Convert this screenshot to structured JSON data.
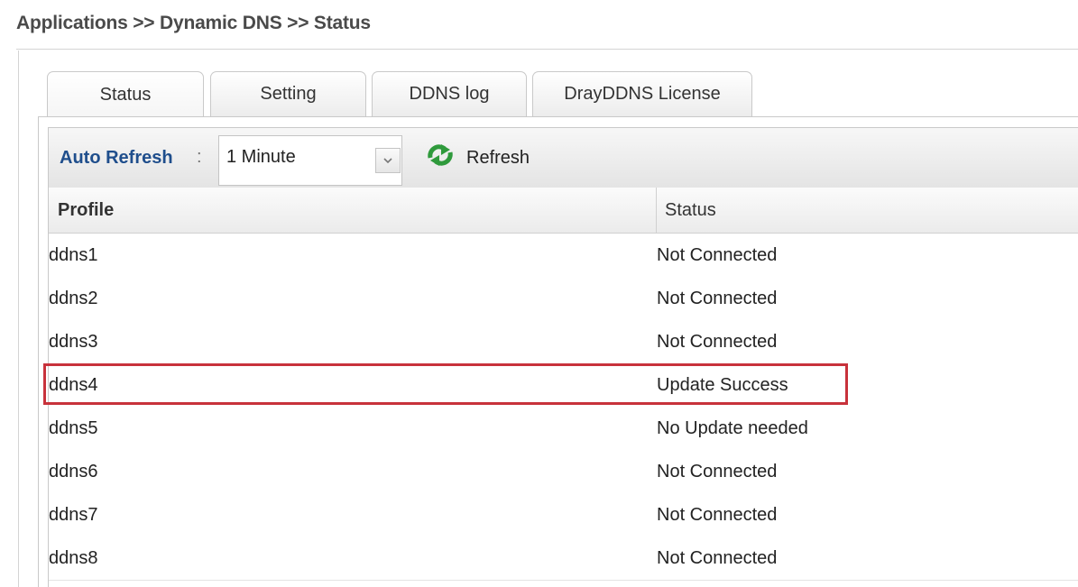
{
  "breadcrumb": "Applications >> Dynamic DNS >> Status",
  "tabs": [
    {
      "label": "Status",
      "active": true
    },
    {
      "label": "Setting",
      "active": false
    },
    {
      "label": "DDNS log",
      "active": false
    },
    {
      "label": "DrayDDNS License",
      "active": false
    }
  ],
  "toolbar": {
    "auto_refresh_label": "Auto Refresh",
    "colon": ":",
    "auto_refresh_value": "1 Minute",
    "refresh_label": "Refresh",
    "refresh_icon": "refresh-icon"
  },
  "table": {
    "headers": {
      "profile": "Profile",
      "status": "Status"
    },
    "rows": [
      {
        "profile": "ddns1",
        "status": "Not Connected"
      },
      {
        "profile": "ddns2",
        "status": "Not Connected"
      },
      {
        "profile": "ddns3",
        "status": "Not Connected"
      },
      {
        "profile": "ddns4",
        "status": "Update Success"
      },
      {
        "profile": "ddns5",
        "status": "No Update needed"
      },
      {
        "profile": "ddns6",
        "status": "Not Connected"
      },
      {
        "profile": "ddns7",
        "status": "Not Connected"
      },
      {
        "profile": "ddns8",
        "status": "Not Connected"
      }
    ]
  },
  "colors": {
    "label_blue": "#1f4e8c",
    "refresh_green": "#2f9a3c",
    "highlight_red": "#c8323b"
  }
}
